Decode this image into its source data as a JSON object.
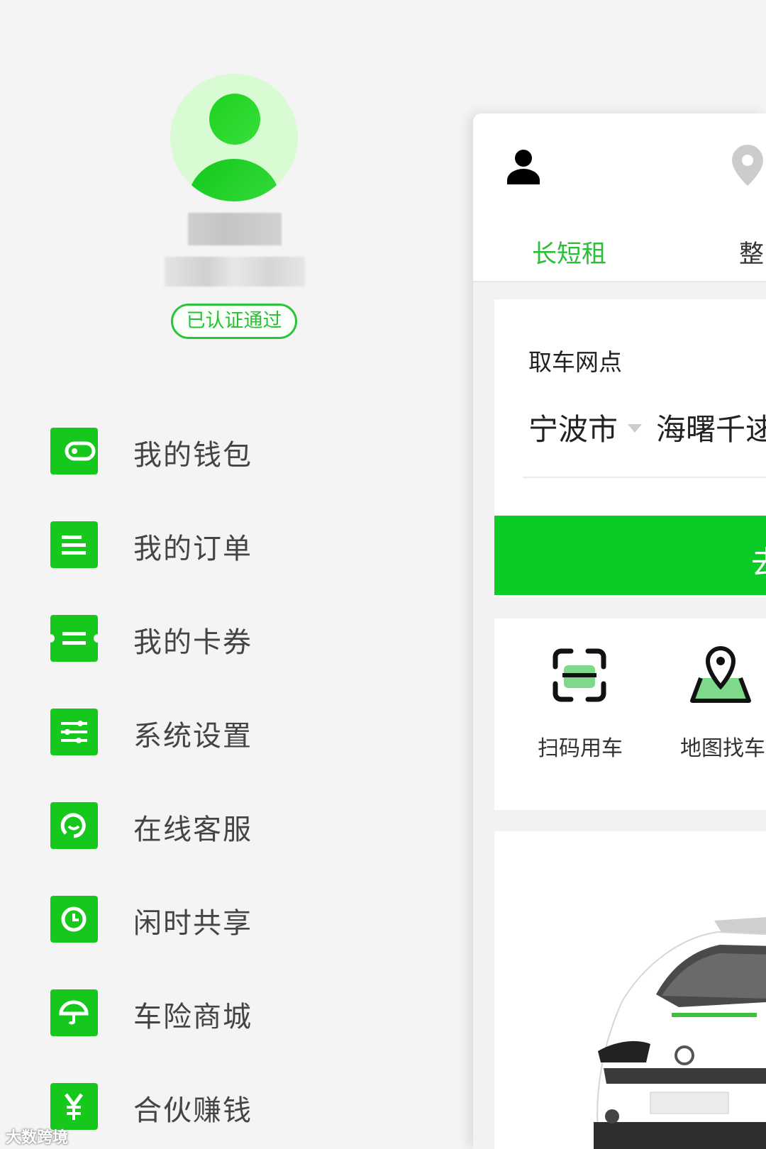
{
  "profile": {
    "avatar_icon": "user-avatar-icon",
    "verified_badge": "已认证通过"
  },
  "menu": {
    "items": [
      {
        "label": "我的钱包",
        "icon": "wallet-icon"
      },
      {
        "label": "我的订单",
        "icon": "order-list-icon"
      },
      {
        "label": "我的卡券",
        "icon": "coupon-icon"
      },
      {
        "label": "系统设置",
        "icon": "settings-sliders-icon"
      },
      {
        "label": "在线客服",
        "icon": "customer-service-icon"
      },
      {
        "label": "闲时共享",
        "icon": "clock-icon"
      },
      {
        "label": "车险商城",
        "icon": "umbrella-icon"
      },
      {
        "label": "合伙赚钱",
        "icon": "yen-icon"
      }
    ]
  },
  "panel": {
    "tabs": {
      "long_short": "长短租",
      "whole": "整"
    },
    "pickup": {
      "label": "取车网点",
      "city": "宁波市",
      "station": "海曙千逑"
    },
    "go_button": "去",
    "quick": {
      "scan_label": "扫码用车",
      "map_label": "地图找车"
    }
  },
  "watermark": "大数跨境",
  "colors": {
    "brand_green": "#16c81c",
    "text_green": "#2cbf3a",
    "button_green": "#0bcb26"
  }
}
